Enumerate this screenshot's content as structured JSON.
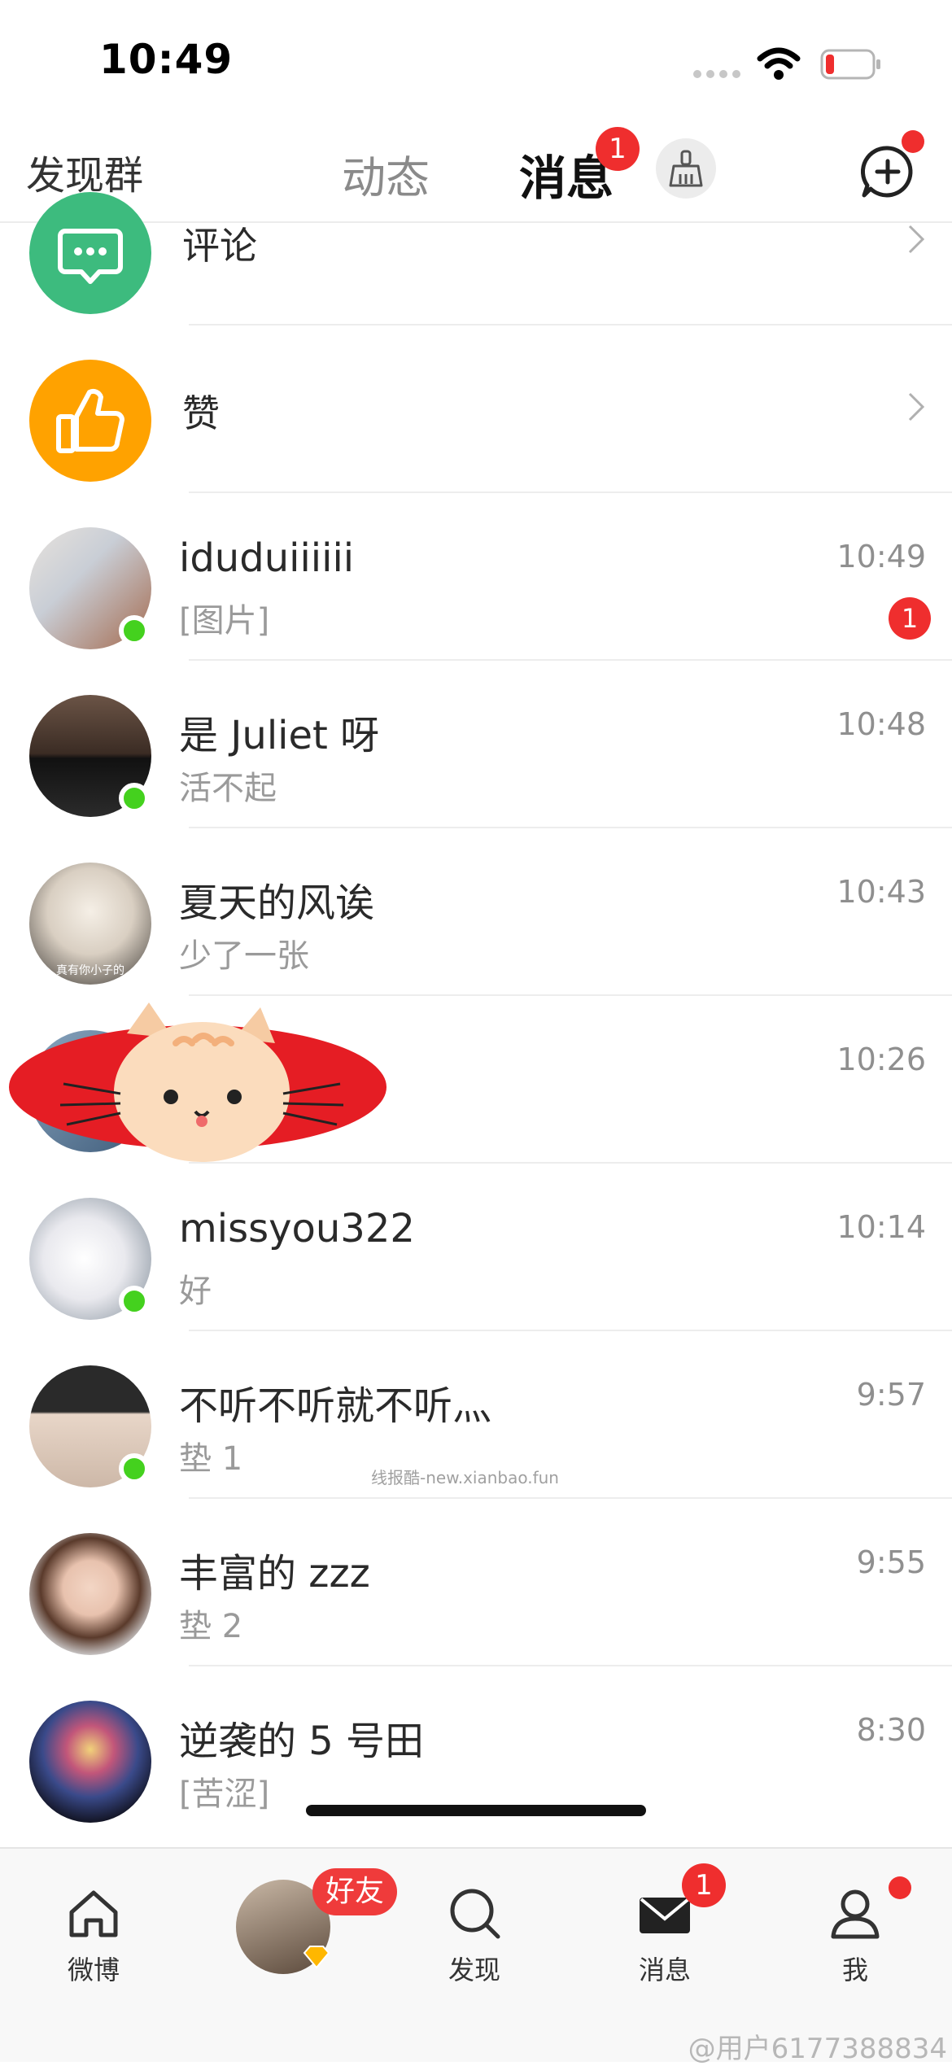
{
  "status_bar": {
    "time": "10:49"
  },
  "top_nav": {
    "discover_groups": "发现群",
    "tab_dongtai": "动态",
    "tab_messages": "消息",
    "messages_badge": "1"
  },
  "function_rows": [
    {
      "label": "评论",
      "icon": "comment-bubble-icon",
      "color": "#3dbb7e"
    },
    {
      "label": "赞",
      "icon": "thumbs-up-icon",
      "color": "#ffa200"
    }
  ],
  "conversations": [
    {
      "name": "iduduiiiiii",
      "preview": "[图片]",
      "time": "10:49",
      "badge": "1",
      "online": true
    },
    {
      "name": "是 Juliet 呀",
      "preview": "活不起",
      "time": "10:48",
      "badge": "",
      "online": true
    },
    {
      "name": "夏天的风诶",
      "preview": "少了一张",
      "time": "10:43",
      "badge": "",
      "online": false,
      "avatar_caption": "真有你小子的"
    },
    {
      "name": "",
      "preview": "",
      "time": "10:26",
      "badge": "",
      "online": false
    },
    {
      "name": "missyou322",
      "preview": "好",
      "time": "10:14",
      "badge": "",
      "online": true
    },
    {
      "name": "不听不听就不听灬",
      "preview": "垫 1",
      "time": "9:57",
      "badge": "",
      "online": true
    },
    {
      "name": "丰富的 zzz",
      "preview": "垫 2",
      "time": "9:55",
      "badge": "",
      "online": false
    },
    {
      "name": "逆袭的 5 号田",
      "preview": "[苦涩]",
      "time": "8:30",
      "badge": "",
      "online": false
    }
  ],
  "tab_bar": {
    "weibo": "微博",
    "friends_pill": "好友",
    "discover": "发现",
    "messages": "消息",
    "messages_badge": "1",
    "me": "我"
  },
  "watermarks": {
    "middle": "线报酷-new.xianbao.fun",
    "bottom": "@用户6177388834"
  },
  "colors": {
    "accent": "#ffa800",
    "badge": "#ef2e2e",
    "online": "#44d11e",
    "comment_green": "#3dbb7e",
    "like_orange": "#ffa200"
  }
}
